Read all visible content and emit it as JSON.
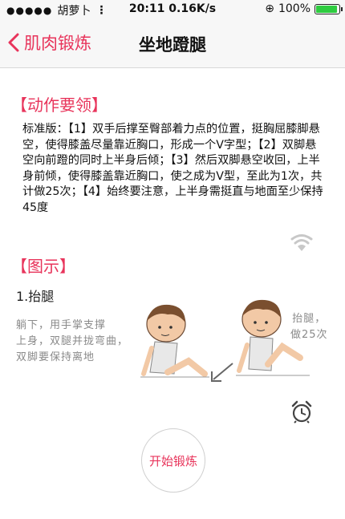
{
  "status_bar": {
    "carrier": "胡萝卜",
    "time": "20:11",
    "speed": "0.16K/s",
    "battery_text": "100%",
    "battery_level": 1.0,
    "battery_color": "#2ecc40"
  },
  "nav": {
    "back_label": "肌肉锻炼",
    "title": "坐地蹬腿",
    "accent": "#e8345b"
  },
  "section_points": {
    "title": "【动作要领】",
    "text": "标准版：【1】双手后撑至臀部着力点的位置，挺胸屈膝脚悬空，使得膝盖尽量靠近胸口，形成一个V字型；【2】双脚悬空向前蹬的同时上半身后倾；【3】然后双脚悬空收回，上半身前倾，使得膝盖靠近胸口，使之成为V型，至此为1次，共计做25次；【4】始终要注意，上半身需挺直与地面至少保持45度"
  },
  "section_figure": {
    "title": "【图示】",
    "step_title": "1.抬腿",
    "note_left": "躺下，用手掌支撑\n上身，双腿并拢弯曲，\n双脚要保持离地",
    "note_right": "抬腿，\n做25次"
  },
  "icons": {
    "sound": "wifi-signal-icon",
    "alarm": "alarm-clock-icon"
  },
  "start_button": {
    "label": "开始锻炼"
  }
}
